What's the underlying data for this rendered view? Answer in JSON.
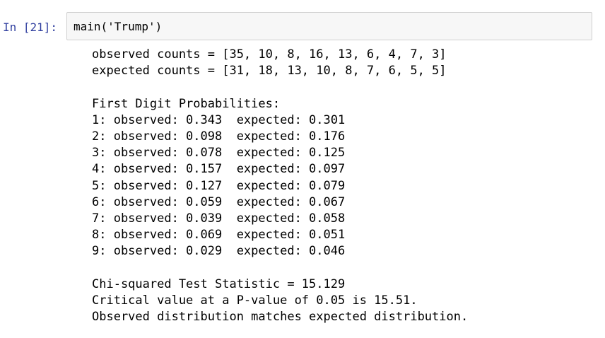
{
  "cell": {
    "prompt": "In [21]:",
    "input_code": "main('Trump')"
  },
  "output": {
    "observed_counts": "observed counts = [35, 10, 8, 16, 13, 6, 4, 7, 3]",
    "expected_counts": "expected counts = [31, 18, 13, 10, 8, 7, 6, 5, 5]",
    "probabilities_header": "First Digit Probabilities:",
    "probabilities": [
      "1: observed: 0.343  expected: 0.301",
      "2: observed: 0.098  expected: 0.176",
      "3: observed: 0.078  expected: 0.125",
      "4: observed: 0.157  expected: 0.097",
      "5: observed: 0.127  expected: 0.079",
      "6: observed: 0.059  expected: 0.067",
      "7: observed: 0.039  expected: 0.058",
      "8: observed: 0.069  expected: 0.051",
      "9: observed: 0.029  expected: 0.046"
    ],
    "chi_squared": "Chi-squared Test Statistic = 15.129",
    "critical_value": "Critical value at a P-value of 0.05 is 15.51.",
    "conclusion": "Observed distribution matches expected distribution."
  },
  "colors": {
    "prompt": "#303f9f",
    "input_border": "#cfcfcf",
    "input_background": "#f7f7f7"
  }
}
